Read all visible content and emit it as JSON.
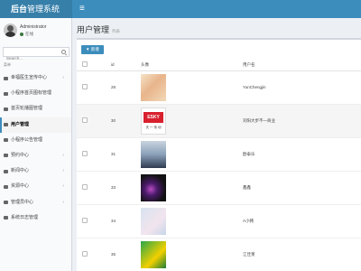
{
  "header": {
    "brand_bold": "后台",
    "brand_rest": "管理系统",
    "menu_toggle": "≡"
  },
  "user": {
    "name": "Administrator",
    "status": "在线"
  },
  "search": {
    "placeholder": "Search..."
  },
  "sidebar": {
    "header": "菜单",
    "items": [
      {
        "label": "幸福医生宣传中心",
        "chevron": "‹",
        "icon": "home-icon"
      },
      {
        "label": "小程序首页图标管理",
        "chevron": "",
        "icon": "image-icon"
      },
      {
        "label": "首页轮播图管理",
        "chevron": "",
        "icon": "slides-icon"
      },
      {
        "label": "用户管理",
        "chevron": "",
        "icon": "user-icon",
        "active": true
      },
      {
        "label": "小程序公告管理",
        "chevron": "",
        "icon": "notice-icon"
      },
      {
        "label": "预约中心",
        "chevron": "‹",
        "icon": "calendar-icon"
      },
      {
        "label": "新闻中心",
        "chevron": "‹",
        "icon": "news-icon"
      },
      {
        "label": "资源中心",
        "chevron": "‹",
        "icon": "folder-icon"
      },
      {
        "label": "管理员中心",
        "chevron": "‹",
        "icon": "admin-icon"
      },
      {
        "label": "系统日志管理",
        "chevron": "",
        "icon": "log-icon"
      }
    ]
  },
  "page": {
    "title": "用户管理",
    "subtitle": "列表"
  },
  "toolbar": {
    "add_label": "▼ 新增"
  },
  "table": {
    "columns": [
      "id",
      "头像",
      "用户名"
    ],
    "rows": [
      {
        "id": "28",
        "username": "YunChengjin",
        "avatar": "avatar-cartoon-image"
      },
      {
        "id": "30",
        "username": "刘阳大步不一商业",
        "avatar": "esky-logo-image"
      },
      {
        "id": "31",
        "username": "欧泰乐",
        "avatar": "portrait-image"
      },
      {
        "id": "33",
        "username": "鑫鑫",
        "avatar": "night-light-image"
      },
      {
        "id": "34",
        "username": "Λ小韩",
        "avatar": "couple-image"
      },
      {
        "id": "35",
        "username": "江佳莱",
        "avatar": "cartoon-green-image"
      }
    ],
    "esky_logo": {
      "main": "ESKY",
      "sub": "天 一 传 动"
    }
  }
}
